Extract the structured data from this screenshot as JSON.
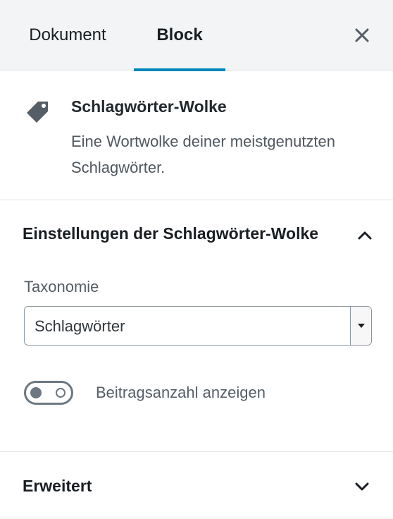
{
  "tabs": {
    "document_label": "Dokument",
    "block_label": "Block",
    "active": "Block"
  },
  "block": {
    "title": "Schlagwörter-Wolke",
    "description": "Eine Wortwolke deiner meistgenutzten Schlagwörter.",
    "icon": "tag-icon"
  },
  "settings": {
    "title": "Einstellungen der Schlagwörter-Wolke",
    "expanded": true,
    "taxonomy_label": "Taxonomie",
    "taxonomy_value": "Schlagwörter",
    "show_count_label": "Beitragsanzahl anzeigen",
    "show_count_enabled": false
  },
  "advanced": {
    "title": "Erweitert",
    "expanded": false
  },
  "colors": {
    "accent": "#0085ba"
  }
}
